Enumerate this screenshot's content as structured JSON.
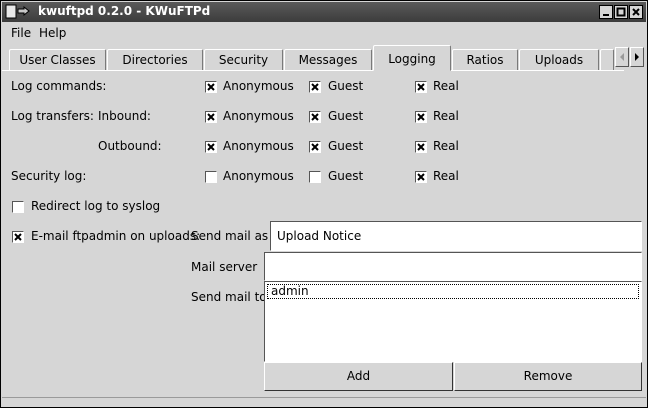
{
  "window": {
    "title": "kwuftpd 0.2.0 - KWuFTPd"
  },
  "menu": {
    "file": "File",
    "help": "Help"
  },
  "tabs": [
    "User Classes",
    "Directories",
    "Security",
    "Messages",
    "Logging",
    "Ratios",
    "Uploads"
  ],
  "tabs_active": "Logging",
  "logging": {
    "log_commands": "Log commands:",
    "log_transfers": "Log transfers:",
    "inbound": "Inbound:",
    "outbound": "Outbound:",
    "security_log": "Security log:",
    "anonymous": "Anonymous",
    "guest": "Guest",
    "real": "Real",
    "rows": [
      {
        "anonymous": true,
        "guest": true,
        "real": true
      },
      {
        "anonymous": true,
        "guest": true,
        "real": true
      },
      {
        "anonymous": true,
        "guest": true,
        "real": true
      },
      {
        "anonymous": false,
        "guest": false,
        "real": true
      }
    ]
  },
  "syslog": {
    "label": "Redirect log to syslog",
    "checked": false
  },
  "email": {
    "label": "E-mail ftpadmin on uploads:",
    "checked": true,
    "send_mail_as_label": "Send mail as",
    "send_mail_as_value": "Upload Notice",
    "mail_server_label": "Mail server",
    "mail_server_value": "",
    "send_mail_to_label": "Send mail to:",
    "recipients": [
      "admin"
    ]
  },
  "buttons": {
    "add": "Add",
    "remove": "Remove"
  }
}
